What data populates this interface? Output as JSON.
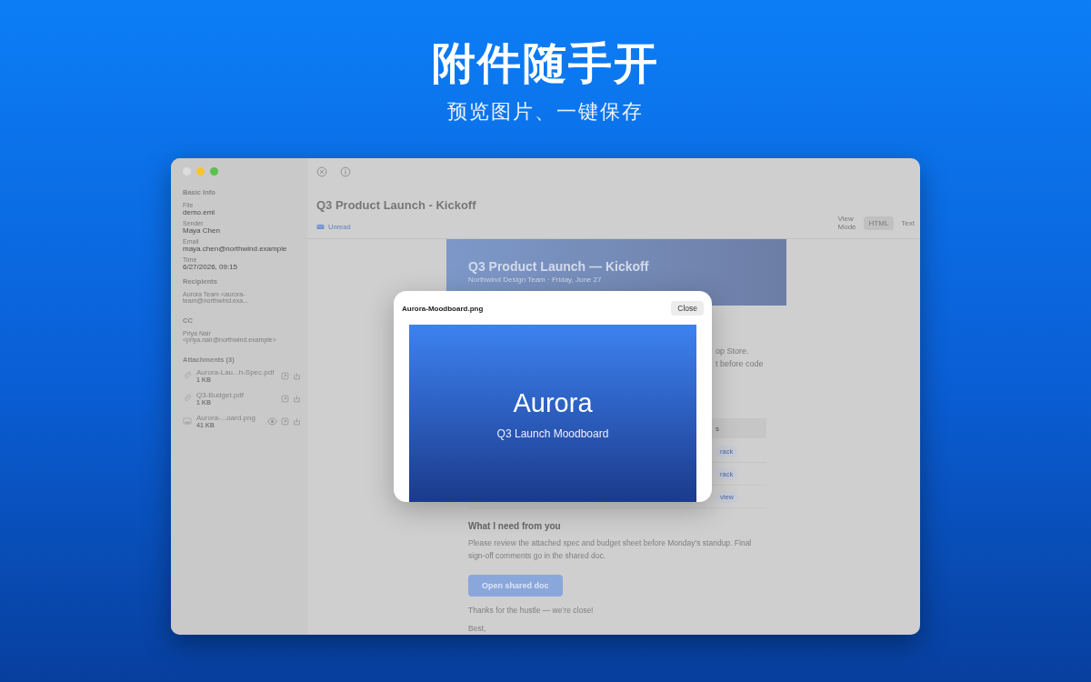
{
  "headline": {
    "title": "附件随手开",
    "subtitle": "预览图片、一键保存"
  },
  "window": {
    "traffic_lights": [
      {
        "color": "#dcdcdc"
      },
      {
        "color": "#f5c431"
      },
      {
        "color": "#5bc04f"
      }
    ]
  },
  "sidebar": {
    "sections": [
      {
        "heading": "Basic Info",
        "fields": [
          {
            "label": "File",
            "value": "demo.eml"
          },
          {
            "label": "Sender",
            "value": "Maya Chen"
          },
          {
            "label": "Email",
            "value": "maya.chen@northwind.example"
          },
          {
            "label": "Time",
            "value": "6/27/2026, 09:15"
          }
        ]
      },
      {
        "heading": "Recipients",
        "note": "Aurora Team <aurora-team@northwind.exa..."
      },
      {
        "heading": "CC",
        "note": "Priya Nair <priya.nair@northwind.example>"
      }
    ],
    "attachments_heading": "Attachments (3)",
    "attachments": [
      {
        "kind": "file",
        "name": "Aurora-Lau...h-Spec.pdf",
        "size": "1 KB"
      },
      {
        "kind": "file",
        "name": "Q3-Budget.pdf",
        "size": "1 KB"
      },
      {
        "kind": "image",
        "name": "Aurora-...oard.png",
        "size": "41 KB"
      }
    ]
  },
  "message": {
    "title": "Q3 Product Launch - Kickoff",
    "unread": true,
    "unread_label": "Unread",
    "view_mode_label": "View Mode",
    "view_modes": [
      {
        "label": "HTML",
        "selected": true
      },
      {
        "label": "Text",
        "selected": false
      }
    ]
  },
  "email": {
    "banner_title": "Q3 Product Launch — Kickoff",
    "banner_subtitle": "Northwind Design Team · Friday, June 27",
    "peek_lines": [
      "op Store.",
      "t before code"
    ],
    "table_header": "s",
    "pills": [
      "rack",
      "rack",
      "view"
    ],
    "section_title": "What I need from you",
    "paragraph": "Please review the attached spec and budget sheet before Monday’s standup. Final sign-off comments go in the shared doc.",
    "button": "Open shared doc",
    "closing": "Thanks for the hustle — we’re close!",
    "signoff": "Best,"
  },
  "preview": {
    "file_name": "Aurora-Moodboard.png",
    "close": "Close",
    "image_title": "Aurora",
    "image_subtitle": "Q3 Launch Moodboard"
  }
}
